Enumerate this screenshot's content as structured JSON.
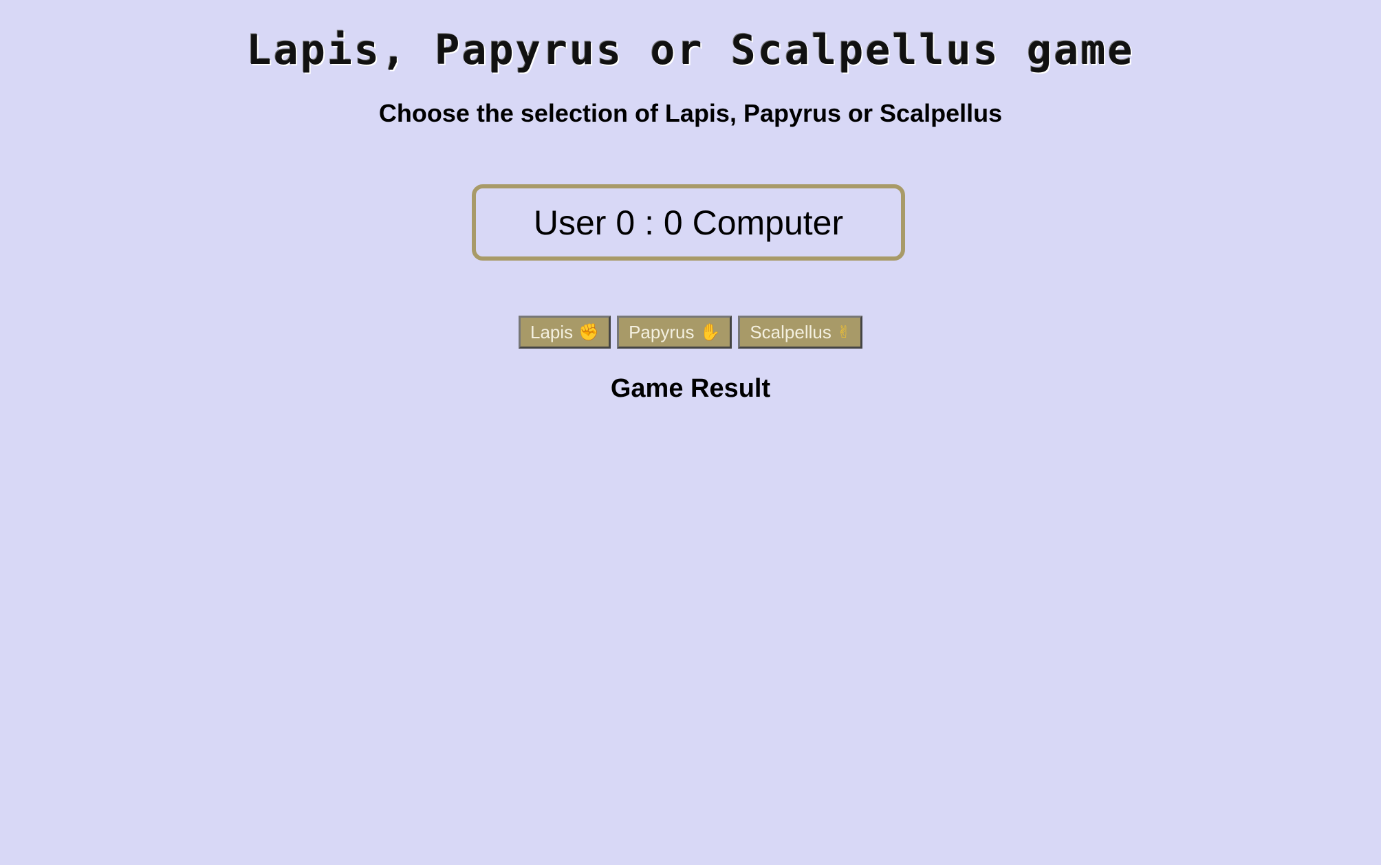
{
  "header": {
    "title": "Lapis, Papyrus or Scalpellus game",
    "subtitle": "Choose the selection of Lapis, Papyrus or Scalpellus"
  },
  "score": {
    "user_label": "User",
    "user_score": "0",
    "separator": ":",
    "computer_score": "0",
    "computer_label": "Computer"
  },
  "choices": [
    {
      "label": "Lapis",
      "emoji": "✊",
      "icon": "fist-icon"
    },
    {
      "label": "Papyrus",
      "emoji": "✋",
      "icon": "hand-icon"
    },
    {
      "label": "Scalpellus",
      "emoji": "✌",
      "icon": "victory-hand-icon"
    }
  ],
  "result": {
    "heading": "Game Result"
  },
  "colors": {
    "background": "#d8d8f6",
    "accent": "#a89a68",
    "button_text": "#f4f0e0"
  }
}
